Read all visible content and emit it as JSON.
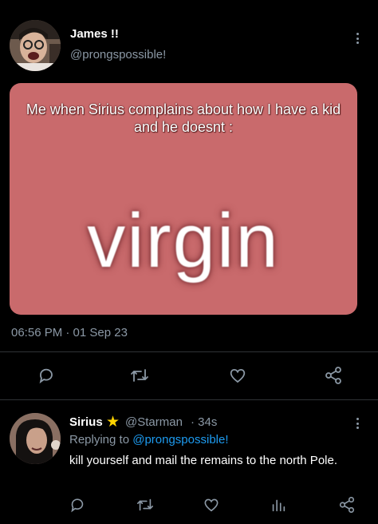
{
  "tweet": {
    "author_name": "James !!",
    "author_handle": "@prongspossible!",
    "meme_caption": "Me when Sirius complains about how I have a kid and he doesnt :",
    "meme_word": "virgin",
    "timestamp": "06:56 PM · 01 Sep 23"
  },
  "reply": {
    "author_name": "Sirius",
    "star": "★",
    "author_handle": "@Starman",
    "age": "· 34s",
    "replying_prefix": "Replying to ",
    "replying_handle": "@prongspossible!",
    "text": "kill yourself and mail the remains to the north Pole."
  },
  "colors": {
    "background": "#000000",
    "secondary_text": "#8b98a5",
    "link": "#1d9bf0",
    "meme_bg": "#c96a6c",
    "star": "#ffd400"
  },
  "icons": [
    "reply-icon",
    "retweet-icon",
    "like-icon",
    "share-icon",
    "views-icon",
    "more-icon"
  ]
}
